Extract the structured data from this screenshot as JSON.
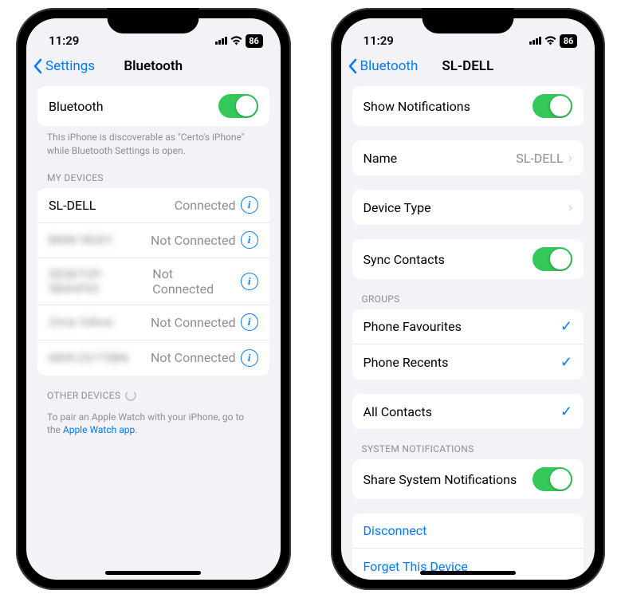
{
  "status": {
    "time": "11:29",
    "battery": "86"
  },
  "phone1": {
    "back": "Settings",
    "title": "Bluetooth",
    "bt_label": "Bluetooth",
    "discoverable": "This iPhone is discoverable as \"Certo's iPhone\" while Bluetooth Settings is open.",
    "my_devices_header": "MY DEVICES",
    "devices": [
      {
        "name": "SL-DELL",
        "status": "Connected",
        "blurred": false
      },
      {
        "name": "BMW 98301",
        "status": "Not Connected",
        "blurred": true
      },
      {
        "name": "DESKTOP-9B4HP03",
        "status": "Not Connected",
        "blurred": true
      },
      {
        "name": "Zima Yellow",
        "status": "Not Connected",
        "blurred": true
      },
      {
        "name": "MDR-ZX770BN",
        "status": "Not Connected",
        "blurred": true
      }
    ],
    "other_devices_header": "OTHER DEVICES",
    "watch_hint_pre": "To pair an Apple Watch with your iPhone, go to the ",
    "watch_hint_link": "Apple Watch app",
    "watch_hint_post": "."
  },
  "phone2": {
    "back": "Bluetooth",
    "title": "SL-DELL",
    "show_notifications": "Show Notifications",
    "name_label": "Name",
    "name_value": "SL-DELL",
    "device_type": "Device Type",
    "sync_contacts": "Sync Contacts",
    "groups_header": "GROUPS",
    "groups": [
      {
        "label": "Phone Favourites",
        "checked": true
      },
      {
        "label": "Phone Recents",
        "checked": true
      }
    ],
    "all_contacts": "All Contacts",
    "sys_header": "SYSTEM NOTIFICATIONS",
    "share_sys": "Share System Notifications",
    "disconnect": "Disconnect",
    "forget": "Forget This Device"
  }
}
